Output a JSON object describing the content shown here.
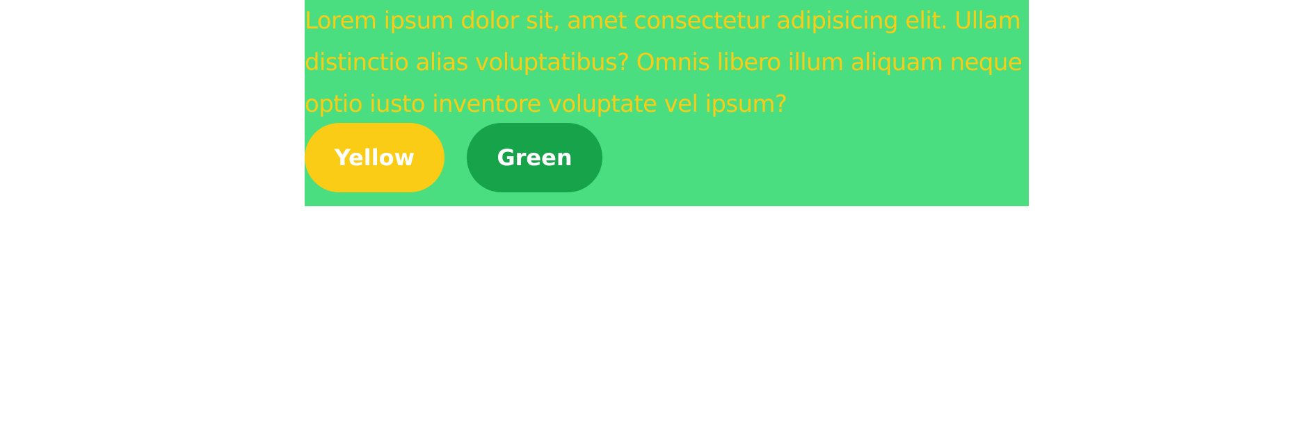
{
  "content": {
    "paragraph": "Lorem ipsum dolor sit, amet consectetur adipisicing elit. Ullam distinctio alias voluptatibus? Omnis libero illum aliquam neque optio iusto inventore voluptate vel ipsum?"
  },
  "buttons": {
    "yellow_label": "Yellow",
    "green_label": "Green"
  },
  "colors": {
    "card_background": "#4ade80",
    "text": "#facc15",
    "yellow_button": "#facc15",
    "green_button": "#16a34a",
    "button_text": "#ffffff"
  }
}
